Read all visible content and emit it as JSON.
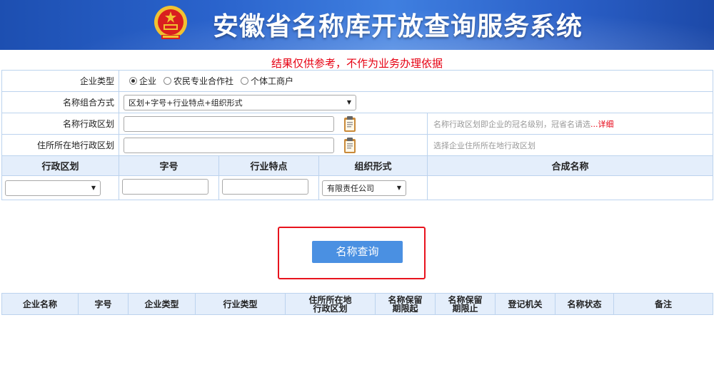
{
  "header": {
    "title": "安徽省名称库开放查询服务系统"
  },
  "notice": "结果仅供参考，不作为业务办理依据",
  "form": {
    "enterprise_type": {
      "label": "企业类型",
      "options": [
        "企业",
        "农民专业合作社",
        "个体工商户"
      ],
      "selected": "企业"
    },
    "combo_method": {
      "label": "名称组合方式",
      "value": "区划+字号+行业特点+组织形式"
    },
    "name_region": {
      "label": "名称行政区划",
      "value": "",
      "hint": "名称行政区划即企业的冠名级别，冠省名请选",
      "hint_link": "...详细"
    },
    "residence_region": {
      "label": "住所所在地行政区划",
      "value": "",
      "hint": "选择企业住所所在地行政区划"
    }
  },
  "grid": {
    "headers": [
      "行政区划",
      "字号",
      "行业特点",
      "组织形式",
      "合成名称"
    ],
    "org_form_value": "有限责任公司",
    "region_value": ""
  },
  "query_button": "名称查询",
  "results": {
    "headers": [
      "企业名称",
      "字号",
      "企业类型",
      "行业类型",
      "住所所在地\n行政区划",
      "名称保留\n期限起",
      "名称保留\n期限止",
      "登记机关",
      "名称状态",
      "备注"
    ]
  },
  "colors": {
    "accent": "#4a90e2",
    "alert": "#e60012",
    "header_bg": "#2a63cc",
    "border": "#bcd3ee",
    "table_head": "#e4eefb"
  }
}
